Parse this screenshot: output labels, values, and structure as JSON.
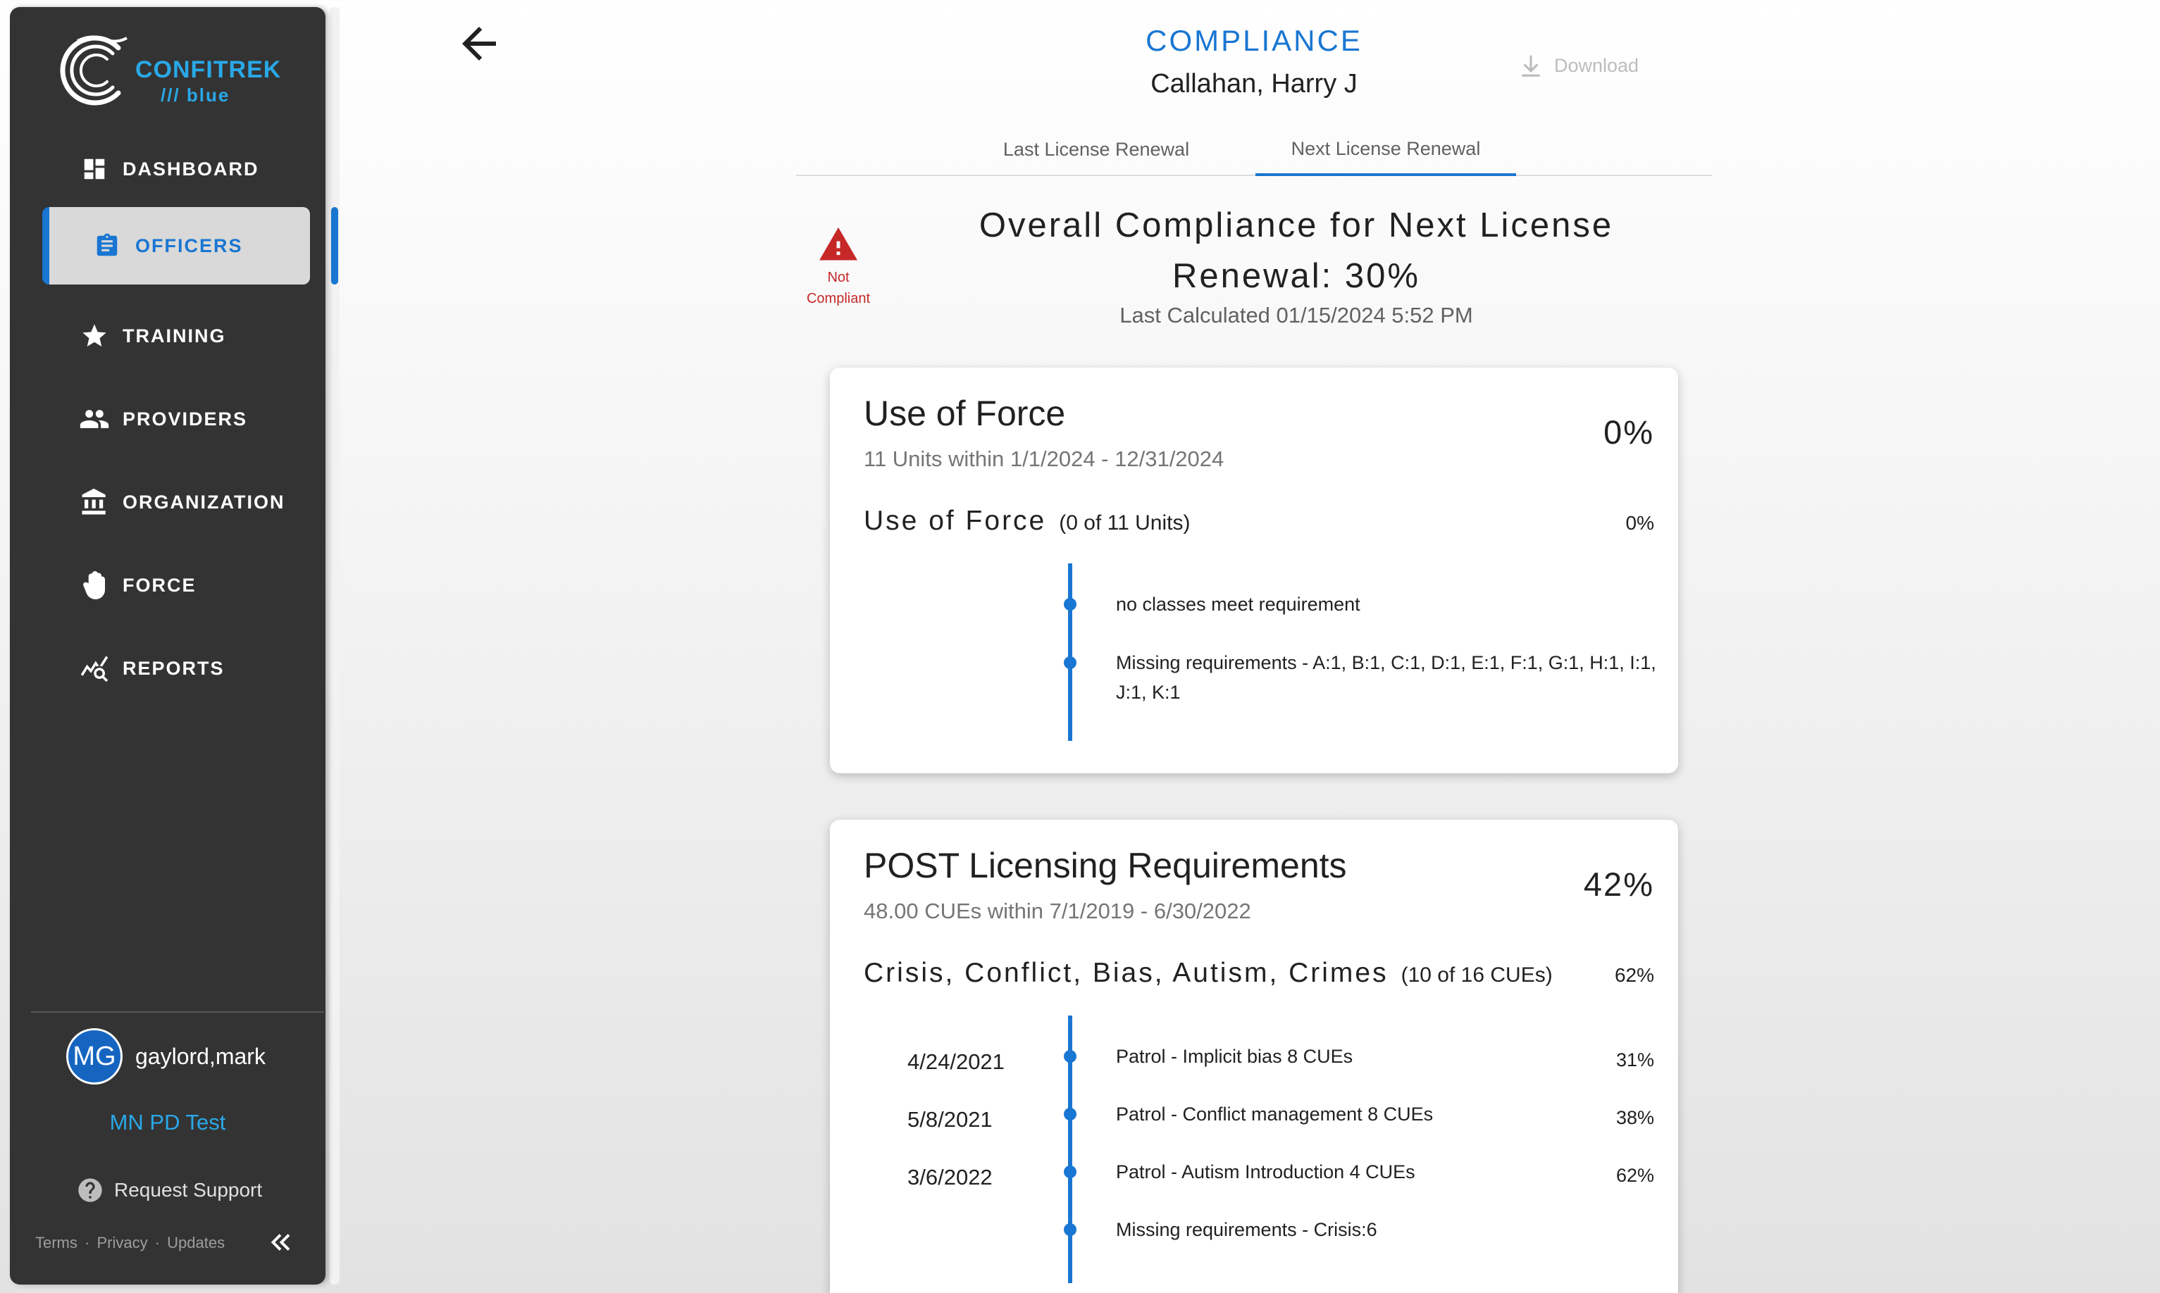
{
  "sidebar": {
    "logo": {
      "brand": "CONFITREK",
      "sub": "/// blue"
    },
    "items": [
      {
        "label": "DASHBOARD",
        "icon": "dashboard-icon"
      },
      {
        "label": "OFFICERS",
        "icon": "clipboard-icon",
        "active": true
      },
      {
        "label": "TRAINING",
        "icon": "star-icon"
      },
      {
        "label": "PROVIDERS",
        "icon": "people-icon"
      },
      {
        "label": "ORGANIZATION",
        "icon": "building-icon"
      },
      {
        "label": "FORCE",
        "icon": "hand-icon"
      },
      {
        "label": "REPORTS",
        "icon": "chart-search-icon"
      }
    ],
    "user": {
      "initials": "MG",
      "name": "gaylord,mark"
    },
    "org": "MN PD Test",
    "support": "Request Support",
    "footer": {
      "terms": "Terms",
      "privacy": "Privacy",
      "updates": "Updates",
      "sep": "·"
    }
  },
  "header": {
    "title": "COMPLIANCE",
    "officer": "Callahan, Harry J",
    "download": "Download",
    "tabs": [
      "Last License Renewal",
      "Next License Renewal"
    ],
    "active_tab": "Next License Renewal"
  },
  "overall": {
    "status": [
      "Not",
      "Compliant"
    ],
    "line1": "Overall Compliance for Next License",
    "line2": "Renewal: 30%",
    "last_calculated": "Last Calculated 01/15/2024 5:52 PM"
  },
  "cards": [
    {
      "title": "Use of Force",
      "subtitle": "11 Units within 1/1/2024 - 12/31/2024",
      "percent": "0%",
      "requirement": {
        "name": "Use of Force",
        "units": "(0 of 11 Units)",
        "percent": "0%"
      },
      "timeline": [
        {
          "text": "no classes meet requirement"
        },
        {
          "text": "Missing requirements - A:1, B:1, C:1, D:1, E:1, F:1, G:1, H:1, I:1,",
          "text2": "J:1, K:1"
        }
      ]
    },
    {
      "title": "POST Licensing Requirements",
      "subtitle": "48.00 CUEs within 7/1/2019 - 6/30/2022",
      "percent": "42%",
      "requirement": {
        "name": "Crisis, Conflict, Bias, Autism, Crimes",
        "units": "(10 of 16 CUEs)",
        "percent": "62%"
      },
      "timeline": [
        {
          "date": "4/24/2021",
          "text": "Patrol - Implicit bias 8 CUEs",
          "percent": "31%"
        },
        {
          "date": "5/8/2021",
          "text": "Patrol - Conflict management 8 CUEs",
          "percent": "38%"
        },
        {
          "date": "3/6/2022",
          "text": "Patrol - Autism Introduction 4 CUEs",
          "percent": "62%"
        },
        {
          "text": "Missing requirements - Crisis:6"
        }
      ]
    }
  ],
  "colors": {
    "accent": "#1976d2",
    "brand": "#29a8e8",
    "sidebar": "#333333",
    "warning": "#c62828"
  }
}
